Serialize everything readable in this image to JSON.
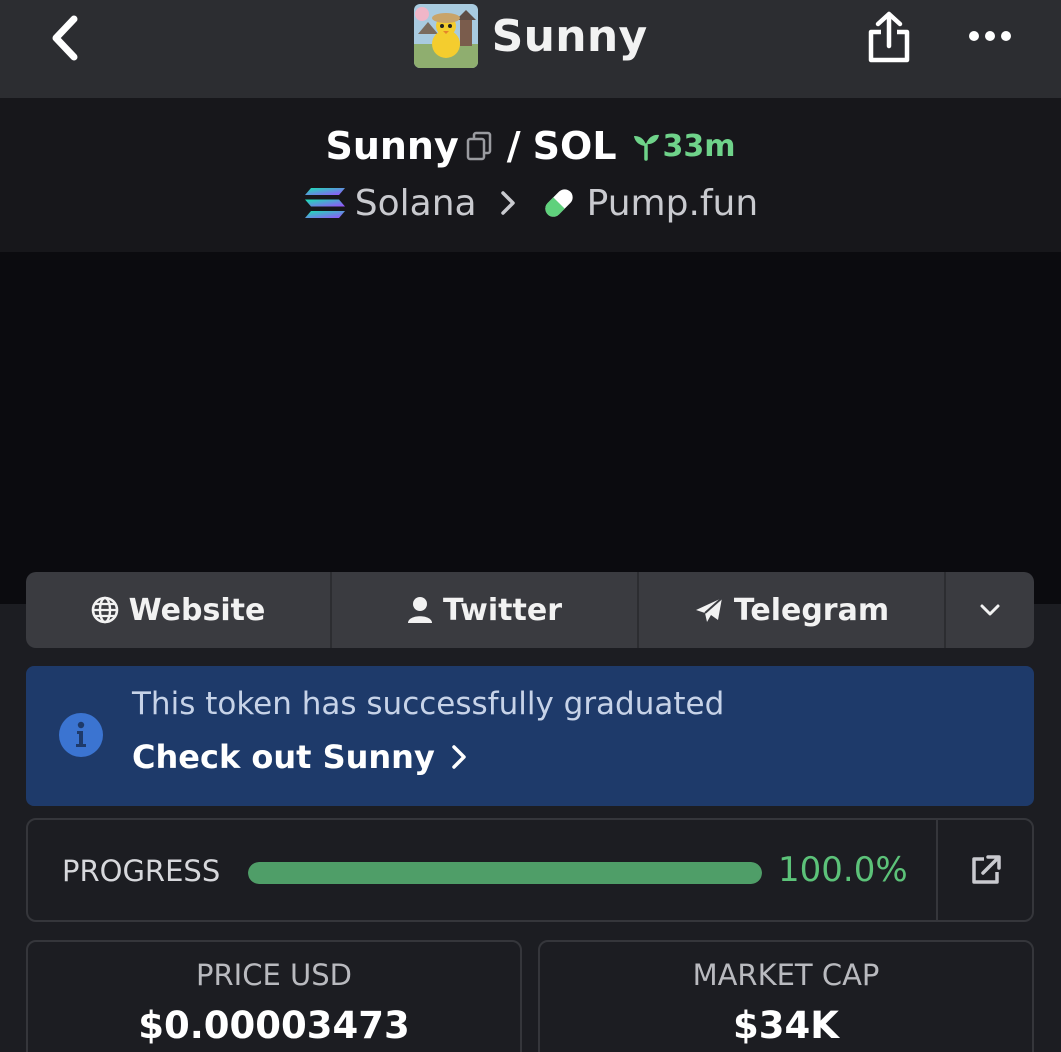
{
  "topbar": {
    "title": "Sunny",
    "back_icon": "chevron-left-icon",
    "share_icon": "share-icon",
    "more_icon": "more-horizontal-icon"
  },
  "pair": {
    "base": "Sunny",
    "separator": "/",
    "quote": "SOL",
    "age": "33m",
    "age_icon": "seedling-icon",
    "chain": "Solana",
    "dex": "Pump.fun"
  },
  "links": [
    {
      "label": "Website",
      "icon": "globe-icon"
    },
    {
      "label": "Twitter",
      "icon": "user-icon"
    },
    {
      "label": "Telegram",
      "icon": "paper-plane-icon"
    }
  ],
  "banner": {
    "message": "This token has successfully graduated",
    "link": "Check out Sunny"
  },
  "progress": {
    "label": "PROGRESS",
    "value_text": "100.0%",
    "fraction": 1.0
  },
  "stats": [
    {
      "label": "PRICE USD",
      "value": "$0.00003473"
    },
    {
      "label": "MARKET CAP",
      "value": "$34K"
    }
  ],
  "colors": {
    "accent_green": "#5cc279",
    "banner_blue": "#1e3a6a",
    "info_blue": "#3b74d1"
  }
}
